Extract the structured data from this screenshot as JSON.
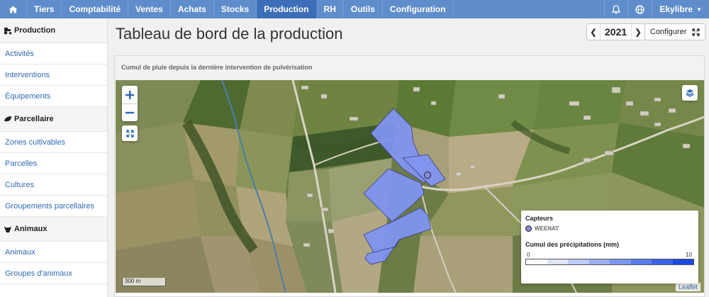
{
  "nav": {
    "items": [
      "Tiers",
      "Comptabilité",
      "Ventes",
      "Achats",
      "Stocks",
      "Production",
      "RH",
      "Outils",
      "Configuration"
    ],
    "active": "Production",
    "user": "Ekylibre"
  },
  "sidebar": {
    "sections": [
      {
        "title": "Production",
        "links": [
          "Activités",
          "Interventions",
          "Équipements"
        ]
      },
      {
        "title": "Parcellaire",
        "links": [
          "Zones cultivables",
          "Parcelles",
          "Cultures",
          "Groupements parcellaires"
        ]
      },
      {
        "title": "Animaux",
        "links": [
          "Animaux",
          "Groupes d'animaux"
        ]
      }
    ]
  },
  "page": {
    "title": "Tableau de bord de la production",
    "year": "2021",
    "configure_label": "Configurer"
  },
  "panel": {
    "title": "Cumul de pluie depuis la dernière intervention de pulvérisation"
  },
  "map": {
    "scale_label": "300 m",
    "attribution": "Leaflet",
    "legend": {
      "sensors_title": "Capteurs",
      "sensor_name": "WEENAT",
      "rain_title": "Cumul des précipitations (mm)",
      "range_min": "0",
      "range_max": "10",
      "scale_colors": [
        "#ffffff",
        "#dde4fb",
        "#bccaf6",
        "#9bb0f2",
        "#7a96ee",
        "#597cea",
        "#3a62e6",
        "#1a48e2"
      ]
    },
    "field_color": "#7f93f0"
  },
  "icons": {
    "home": "home-icon",
    "bell": "bell-icon",
    "help": "globe-icon",
    "layers": "layers-icon"
  }
}
